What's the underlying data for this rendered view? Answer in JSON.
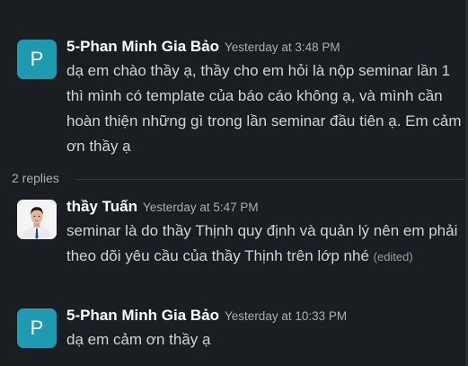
{
  "thread": {
    "parent": {
      "avatar_letter": "P",
      "author": "5-Phan Minh Gia Bảo",
      "timestamp": "Yesterday at 3:48 PM",
      "text": "dạ em chào thầy ạ, thầy cho em hỏi là nộp seminar lần 1 thì mình có template của báo cáo không ạ, và mình cần hoàn thiện những gì trong lần seminar đầu tiên ạ. Em cảm ơn thầy ạ"
    },
    "replies_label": "2 replies",
    "replies": [
      {
        "author": "thầy Tuấn",
        "timestamp": "Yesterday at 5:47 PM",
        "text": "seminar là do thầy Thịnh quy định và quản lý nên em phải theo dõi yêu cầu của thầy Thịnh trên lớp nhé",
        "edited_label": "(edited)"
      },
      {
        "avatar_letter": "P",
        "author": "5-Phan Minh Gia Bảo",
        "timestamp": "Yesterday at 10:33 PM",
        "text": "dạ em cảm ơn thầy ạ"
      }
    ]
  },
  "colors": {
    "background": "#1a1d21",
    "avatar_teal": "#1e9bb0",
    "author_text": "#ffffff",
    "body_text": "#d1d2d3",
    "muted_text": "#abacad"
  }
}
